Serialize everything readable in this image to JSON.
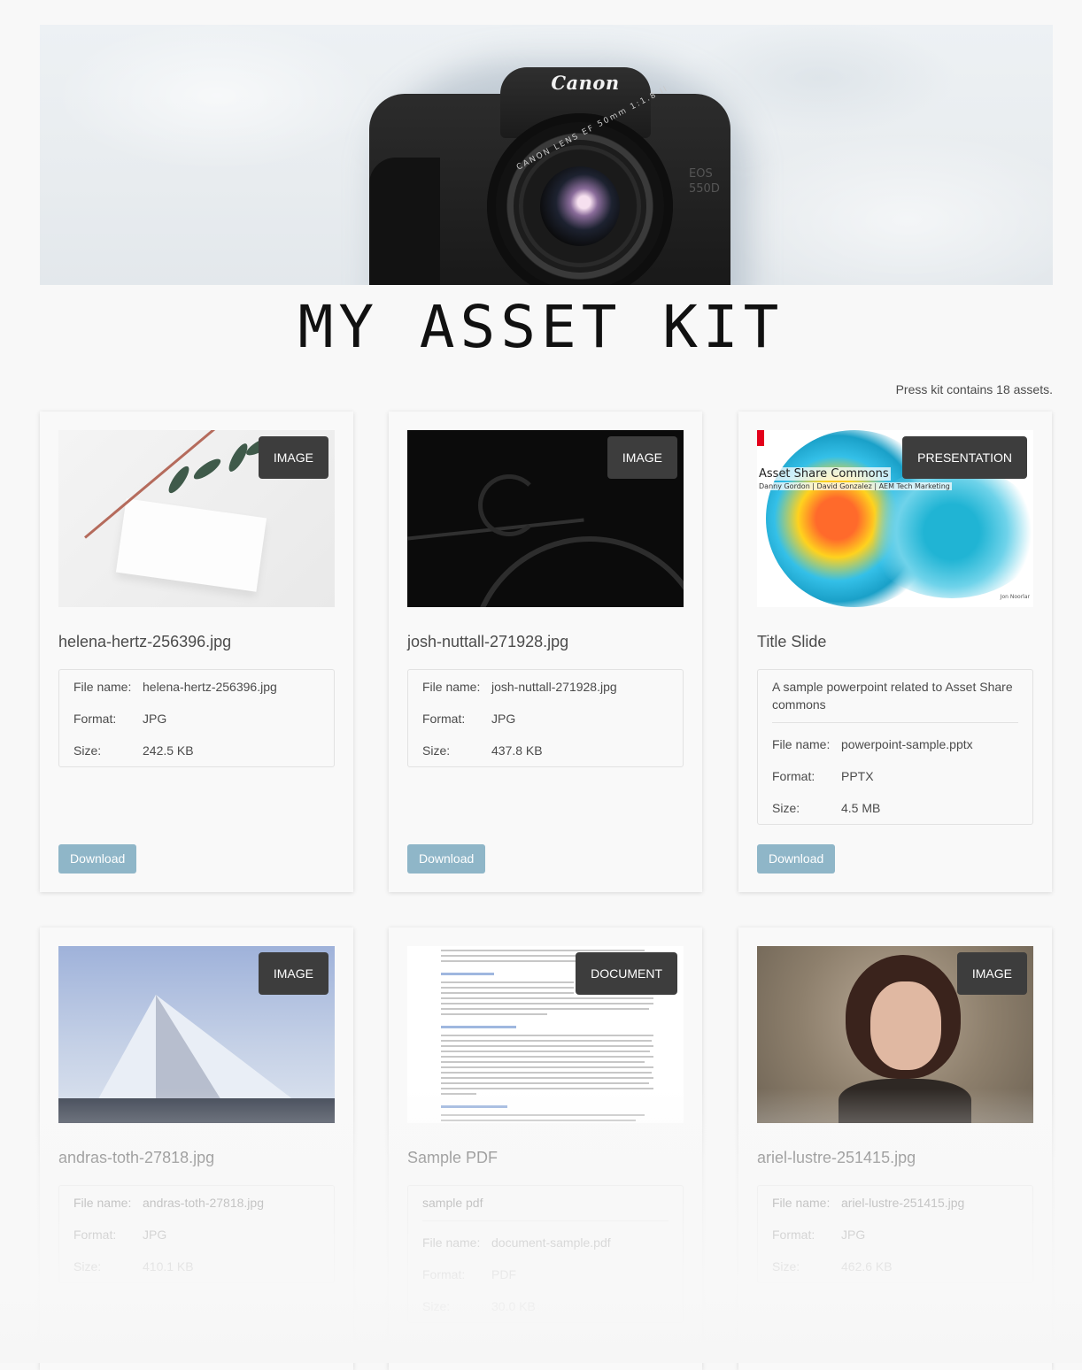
{
  "header": {
    "title": "MY ASSET KIT",
    "camera_brand": "Canon",
    "lens_text": "CANON LENS EF 50mm 1:1.8 II",
    "model_line1": "EOS",
    "model_line2": "550D",
    "asset_count_text": "Press kit contains 18 assets."
  },
  "labels": {
    "file_name": "File name:",
    "format": "Format:",
    "size": "Size:",
    "download": "Download"
  },
  "assets": [
    {
      "type": "IMAGE",
      "title": "helena-hertz-256396.jpg",
      "file_name": "helena-hertz-256396.jpg",
      "format": "JPG",
      "size": "242.5 KB"
    },
    {
      "type": "IMAGE",
      "title": "josh-nuttall-271928.jpg",
      "file_name": "josh-nuttall-271928.jpg",
      "format": "JPG",
      "size": "437.8 KB"
    },
    {
      "type": "PRESENTATION",
      "title": "Title Slide",
      "description": "A sample powerpoint related to Asset Share commons",
      "file_name": "powerpoint-sample.pptx",
      "format": "PPTX",
      "size": "4.5 MB",
      "thumb_title": "Asset Share Commons",
      "thumb_subtitle": "Danny Gordon | David Gonzalez | AEM Tech Marketing",
      "thumb_author": "Jon Noorlar"
    },
    {
      "type": "IMAGE",
      "title": "andras-toth-27818.jpg",
      "file_name": "andras-toth-27818.jpg",
      "format": "JPG",
      "size": "410.1 KB"
    },
    {
      "type": "DOCUMENT",
      "title": "Sample PDF",
      "description": "sample pdf",
      "file_name": "document-sample.pdf",
      "format": "PDF",
      "size": "30.0 KB"
    },
    {
      "type": "IMAGE",
      "title": "ariel-lustre-251415.jpg",
      "file_name": "ariel-lustre-251415.jpg",
      "format": "JPG",
      "size": "462.6 KB"
    }
  ]
}
